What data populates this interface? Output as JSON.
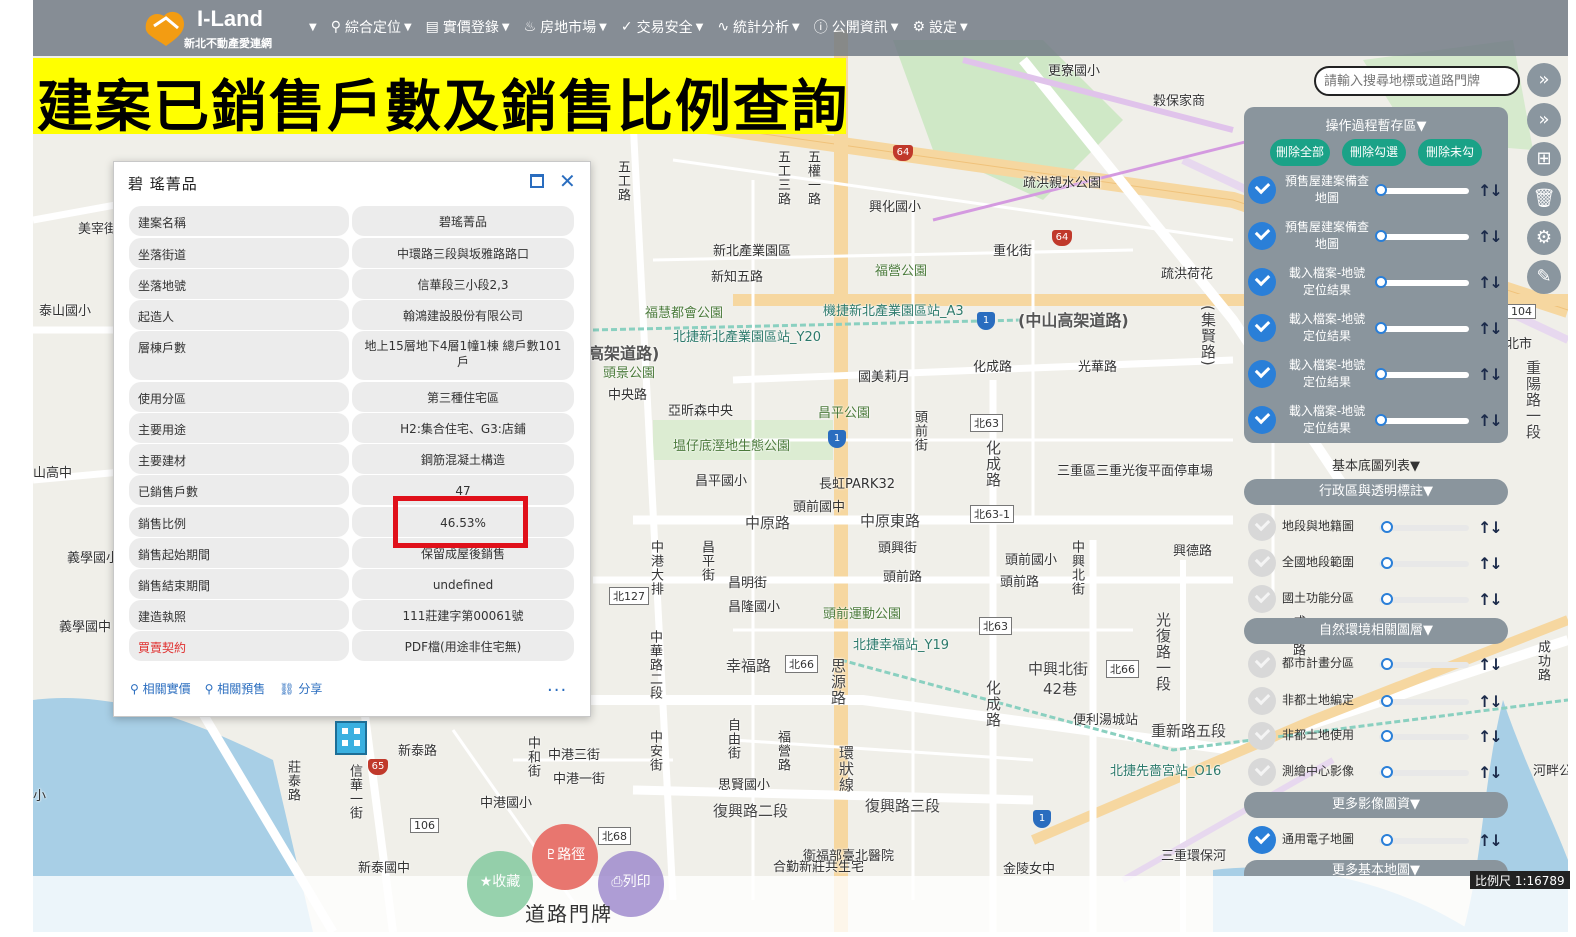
{
  "header": {
    "logo_title": "I-Land",
    "logo_subtitle": "新北不動產愛連網",
    "nav": [
      {
        "label": "綜合定位",
        "icon": "pin-icon"
      },
      {
        "label": "實價登錄",
        "icon": "document-icon"
      },
      {
        "label": "房地市場",
        "icon": "flame-icon"
      },
      {
        "label": "交易安全",
        "icon": "check-circle-icon"
      },
      {
        "label": "統計分析",
        "icon": "pulse-icon"
      },
      {
        "label": "公開資訊",
        "icon": "info-icon"
      },
      {
        "label": "設定",
        "icon": "gear-icon"
      }
    ]
  },
  "banner": {
    "text": "建案已銷售戶數及銷售比例查詢",
    "color": "#ffff00"
  },
  "search": {
    "placeholder": "請輸入搜尋地標或道路門牌"
  },
  "popup": {
    "title": "碧 瑤菁品",
    "rows": [
      {
        "key": "建案名稱",
        "value": "碧瑤菁品"
      },
      {
        "key": "坐落街道",
        "value": "中環路三段與坂雅路路口"
      },
      {
        "key": "坐落地號",
        "value": "信華段三小段2,3"
      },
      {
        "key": "起造人",
        "value": "翰鴻建設股份有限公司"
      },
      {
        "key": "層棟戶數",
        "value": "地上15層地下4層1幢1棟 總戶數101戶"
      },
      {
        "key": "使用分區",
        "value": "第三種住宅區"
      },
      {
        "key": "主要用途",
        "value": "H2:集合住宅、G3:店鋪"
      },
      {
        "key": "主要建材",
        "value": "鋼筋混凝土構造"
      },
      {
        "key": "已銷售戶數",
        "value": "47"
      },
      {
        "key": "銷售比例",
        "value": "46.53%"
      },
      {
        "key": "銷售起始期間",
        "value": "保留成屋後銷售"
      },
      {
        "key": "銷售結束期間",
        "value": "undefined"
      },
      {
        "key": "建造執照",
        "value": "111莊建字第00061號"
      },
      {
        "key": "買賣契約",
        "value": "PDF檔(用途非住宅無)"
      }
    ],
    "footer": [
      "相關實價",
      "相關預售",
      "分享"
    ],
    "more": "..."
  },
  "panel": {
    "work_header": "操作過程暫存區▼",
    "buttons": [
      "刪除全部",
      "刪除勾選",
      "刪除未勾"
    ],
    "work_layers": [
      {
        "line1": "預售屋建案備查",
        "line2": "地圖"
      },
      {
        "line1": "預售屋建案備查",
        "line2": "地圖"
      },
      {
        "line1": "載入檔案-地號",
        "line2": "定位結果"
      },
      {
        "line1": "載入檔案-地號",
        "line2": "定位結果"
      },
      {
        "line1": "載入檔案-地號",
        "line2": "定位結果"
      },
      {
        "line1": "載入檔案-地號",
        "line2": "定位結果"
      }
    ],
    "base_header": "基本底圖列表▼",
    "admin_header": "行政區與透明標註▼",
    "admin_layers": [
      "地段與地籍圖",
      "全國地段範圍",
      "國土功能分區"
    ],
    "env_header": "自然環境相關圖層▼",
    "env_layers": [
      "都市計畫分區",
      "非都土地編定",
      "非都土地使用",
      "測繪中心影像"
    ],
    "image_header": "更多影像圖資▼",
    "image_layers": [
      "通用電子地圖"
    ],
    "more_header": "更多基本地圖▼"
  },
  "bottom": {
    "label": "道路門牌",
    "fabs": [
      "路徑",
      "收藏",
      "列印"
    ],
    "fab_colors": [
      "#e8766f",
      "#7ec89b",
      "#9b86cc"
    ]
  },
  "scale": "比例尺 1:16789"
}
